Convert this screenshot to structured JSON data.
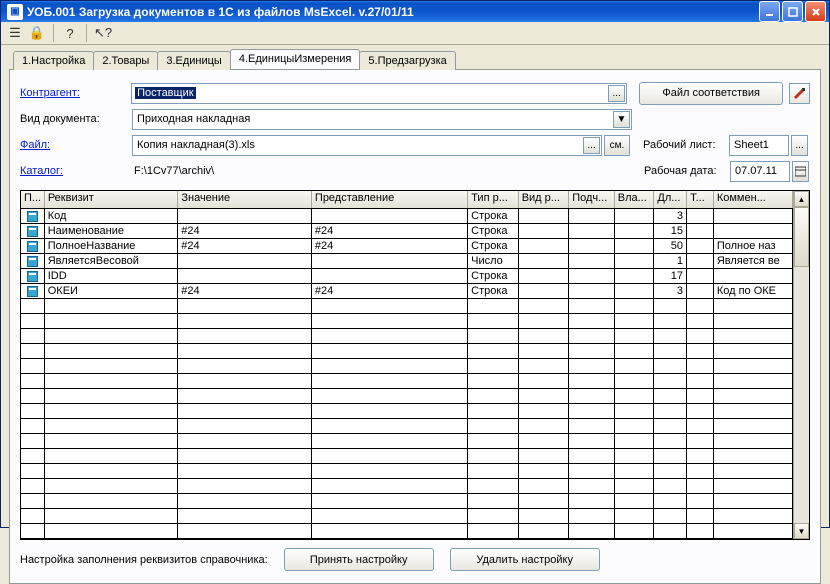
{
  "window": {
    "title": "УОБ.001 Загрузка документов в 1С из файлов MsExcel. v.27/01/11"
  },
  "tabs": {
    "items": [
      {
        "label": "1.Настройка"
      },
      {
        "label": "2.Товары"
      },
      {
        "label": "3.Единицы"
      },
      {
        "label": "4.ЕдиницыИзмерения"
      },
      {
        "label": "5.Предзагрузка"
      }
    ],
    "activeIndex": 3
  },
  "form": {
    "kontragent_label": "Контрагент:",
    "kontragent_value": "Поставщик",
    "viddoc_label": "Вид документа:",
    "viddoc_value": "Приходная накладная",
    "file_label": "Файл:",
    "file_value": "Копия накладная(3).xls",
    "katalog_label": "Каталог:",
    "katalog_value": "F:\\1Cv77\\archiv\\",
    "match_button": "Файл соответствия",
    "sheet_label": "Рабочий лист:",
    "sheet_value": "Sheet1",
    "date_label": "Рабочая дата:",
    "date_value": "07.07.11",
    "ellipsis": "...",
    "sm": "см."
  },
  "grid": {
    "columns": [
      {
        "label": "П..."
      },
      {
        "label": "Реквизит"
      },
      {
        "label": "Значение"
      },
      {
        "label": "Представление"
      },
      {
        "label": "Тип р..."
      },
      {
        "label": "Вид р..."
      },
      {
        "label": "Подч..."
      },
      {
        "label": "Вла..."
      },
      {
        "label": "Дл..."
      },
      {
        "label": "Т..."
      },
      {
        "label": "Коммен..."
      }
    ],
    "rows": [
      {
        "rekvizit": "Код",
        "zn": "",
        "pred": "",
        "tip": "Строка",
        "vid": "",
        "pod": "",
        "vla": "",
        "dl": "3",
        "t": "",
        "kom": ""
      },
      {
        "rekvizit": "Наименование",
        "zn": "#24",
        "pred": "#24",
        "tip": "Строка",
        "vid": "",
        "pod": "",
        "vla": "",
        "dl": "15",
        "t": "",
        "kom": ""
      },
      {
        "rekvizit": "ПолноеНазвание",
        "zn": "#24",
        "pred": "#24",
        "tip": "Строка",
        "vid": "",
        "pod": "",
        "vla": "",
        "dl": "50",
        "t": "",
        "kom": "Полное наз"
      },
      {
        "rekvizit": "ЯвляетсяВесовой",
        "zn": "",
        "pred": "",
        "tip": "Число",
        "vid": "",
        "pod": "",
        "vla": "",
        "dl": "1",
        "t": "",
        "kom": "Является ве"
      },
      {
        "rekvizit": "IDD",
        "zn": "",
        "pred": "",
        "tip": "Строка",
        "vid": "",
        "pod": "",
        "vla": "",
        "dl": "17",
        "t": "",
        "kom": ""
      },
      {
        "rekvizit": "ОКЕИ",
        "zn": "#24",
        "pred": "#24",
        "tip": "Строка",
        "vid": "",
        "pod": "",
        "vla": "",
        "dl": "3",
        "t": "",
        "kom": "Код по ОКЕ"
      }
    ],
    "emptyRows": 16
  },
  "footer": {
    "label": "Настройка заполнения реквизитов справочника:",
    "apply": "Принять настройку",
    "delete": "Удалить настройку"
  },
  "icons": {
    "minimize": "_",
    "maximize": "□",
    "close": "X",
    "dropdown": "▼",
    "up": "▲",
    "down": "▼"
  }
}
